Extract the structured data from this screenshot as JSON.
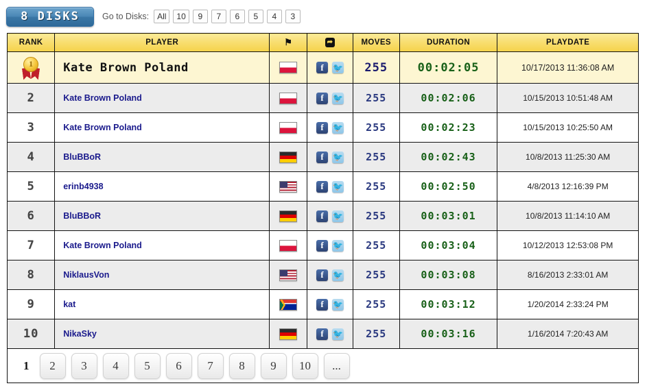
{
  "header": {
    "badge_label": "8 DISKS",
    "goto_label": "Go to Disks:",
    "disk_links": [
      "All",
      "10",
      "9",
      "7",
      "6",
      "5",
      "4",
      "3"
    ]
  },
  "table": {
    "columns": {
      "rank": "RANK",
      "player": "PLAYER",
      "flag": "flag-icon",
      "share": "share-icon",
      "moves": "MOVES",
      "duration": "DURATION",
      "playdate": "PLAYDATE"
    },
    "rows": [
      {
        "rank": "1",
        "rank_icon": "gold-medal-icon",
        "player": "Kate Brown Poland",
        "flag": "pl",
        "flag_name": "flag-poland",
        "moves": "255",
        "duration": "00:02:05",
        "playdate": "10/17/2013 11:36:08 AM"
      },
      {
        "rank": "2",
        "player": "Kate Brown Poland",
        "flag": "pl",
        "flag_name": "flag-poland",
        "moves": "255",
        "duration": "00:02:06",
        "playdate": "10/15/2013 10:51:48 AM"
      },
      {
        "rank": "3",
        "player": "Kate Brown Poland",
        "flag": "pl",
        "flag_name": "flag-poland",
        "moves": "255",
        "duration": "00:02:23",
        "playdate": "10/15/2013 10:25:50 AM"
      },
      {
        "rank": "4",
        "player": "BluBBoR",
        "flag": "de",
        "flag_name": "flag-germany",
        "moves": "255",
        "duration": "00:02:43",
        "playdate": "10/8/2013 11:25:30 AM"
      },
      {
        "rank": "5",
        "player": "erinb4938",
        "flag": "us",
        "flag_name": "flag-united-states",
        "moves": "255",
        "duration": "00:02:50",
        "playdate": "4/8/2013 12:16:39 PM"
      },
      {
        "rank": "6",
        "player": "BluBBoR",
        "flag": "de",
        "flag_name": "flag-germany",
        "moves": "255",
        "duration": "00:03:01",
        "playdate": "10/8/2013 11:14:10 AM"
      },
      {
        "rank": "7",
        "player": "Kate Brown Poland",
        "flag": "pl",
        "flag_name": "flag-poland",
        "moves": "255",
        "duration": "00:03:04",
        "playdate": "10/12/2013 12:53:08 PM"
      },
      {
        "rank": "8",
        "player": "NiklausVon",
        "flag": "us",
        "flag_name": "flag-united-states",
        "moves": "255",
        "duration": "00:03:08",
        "playdate": "8/16/2013 2:33:01 AM"
      },
      {
        "rank": "9",
        "player": "kat",
        "flag": "za",
        "flag_name": "flag-south-africa",
        "moves": "255",
        "duration": "00:03:12",
        "playdate": "1/20/2014 2:33:24 PM"
      },
      {
        "rank": "10",
        "player": "NikaSky",
        "flag": "de",
        "flag_name": "flag-germany",
        "moves": "255",
        "duration": "00:03:16",
        "playdate": "1/16/2014 7:20:43 AM"
      }
    ],
    "share_icons": {
      "facebook": "f",
      "twitter": "🐦"
    }
  },
  "pagination": {
    "current": "1",
    "pages": [
      "2",
      "3",
      "4",
      "5",
      "6",
      "7",
      "8",
      "9",
      "10",
      "..."
    ]
  },
  "colors": {
    "header_yellow": "#f5d24a",
    "top_row_cream": "#fdf6d2",
    "alt_row_gray": "#ececec",
    "player_link_blue": "#1a1a8c",
    "duration_green": "#186018",
    "moves_blue": "#2b3a80",
    "badge_blue": "#3a77a6"
  }
}
